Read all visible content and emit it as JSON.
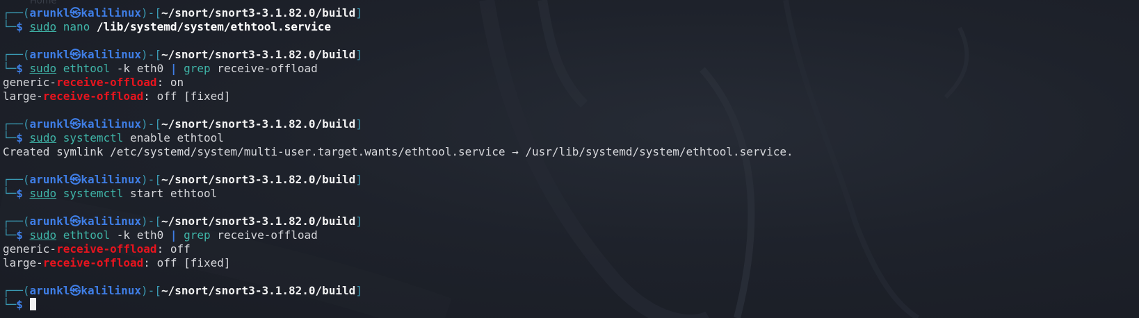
{
  "prompt": {
    "user": "arunkl",
    "at_symbol": "㉿",
    "host": "kalilinux",
    "dir": "~/snort/snort3-3.1.82.0/build",
    "top_open": "┌──(",
    "mid_sep": ")-[",
    "top_close": "]",
    "bottom": "└─",
    "dollar": "$"
  },
  "desktop_label": "Home",
  "blocks": [
    {
      "cmd": {
        "sudo": "sudo",
        "prog": "nano",
        "args": " /lib/systemd/system/ethtool.service"
      },
      "output": []
    },
    {
      "cmd": {
        "sudo": "sudo",
        "prog": "ethtool",
        "opt": " -k eth0 ",
        "pipe": "|",
        "prog2": "grep",
        "args": " receive-offload"
      },
      "output": [
        {
          "pre": "generic-",
          "hl": "receive-offload",
          "post": ": on"
        },
        {
          "pre": "large-",
          "hl": "receive-offload",
          "post": ": off [fixed]"
        }
      ]
    },
    {
      "cmd": {
        "sudo": "sudo",
        "prog": "systemctl",
        "args": " enable ethtool"
      },
      "output_text": "Created symlink /etc/systemd/system/multi-user.target.wants/ethtool.service → /usr/lib/systemd/system/ethtool.service."
    },
    {
      "cmd": {
        "sudo": "sudo",
        "prog": "systemctl",
        "args": " start ethtool"
      },
      "output": []
    },
    {
      "cmd": {
        "sudo": "sudo",
        "prog": "ethtool",
        "opt": " -k eth0 ",
        "pipe": "|",
        "prog2": "grep",
        "args": " receive-offload"
      },
      "output": [
        {
          "pre": "generic-",
          "hl": "receive-offload",
          "post": ": off"
        },
        {
          "pre": "large-",
          "hl": "receive-offload",
          "post": ": off [fixed]"
        }
      ]
    }
  ]
}
